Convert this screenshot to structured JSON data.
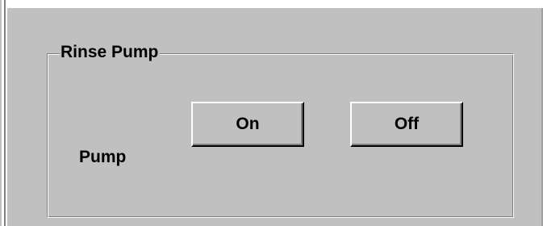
{
  "rinse_pump": {
    "group_title": "Rinse Pump",
    "label": "Pump",
    "buttons": {
      "on_label": "On",
      "off_label": "Off"
    }
  },
  "colors": {
    "panel_background": "#c0c0c0",
    "page_background": "#ffffff",
    "text": "#000000",
    "shadow": "#808080",
    "highlight": "#ffffff"
  }
}
